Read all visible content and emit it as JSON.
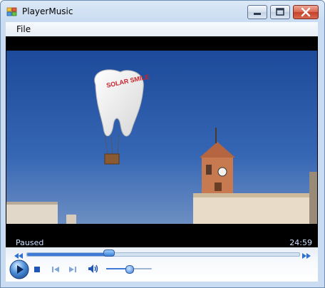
{
  "window": {
    "title": "PlayerMusic"
  },
  "menu": {
    "file_label": "File"
  },
  "player": {
    "status": "Paused",
    "time": "24:59",
    "seek_progress": 0.3,
    "volume_level": 0.5
  },
  "colors": {
    "accent": "#3d7bd6",
    "overlay_text": "#cfe1ff",
    "video_background": "#000000",
    "sky": "#2a5aa8"
  },
  "icons": {
    "app": "app-icon",
    "minimize": "minimize-icon",
    "maximize": "maximize-icon",
    "close": "close-icon",
    "rewind": "rewind-icon",
    "fast_forward": "fast-forward-icon",
    "play": "play-icon",
    "stop": "stop-icon",
    "previous": "previous-icon",
    "next": "next-icon",
    "volume": "volume-icon"
  }
}
